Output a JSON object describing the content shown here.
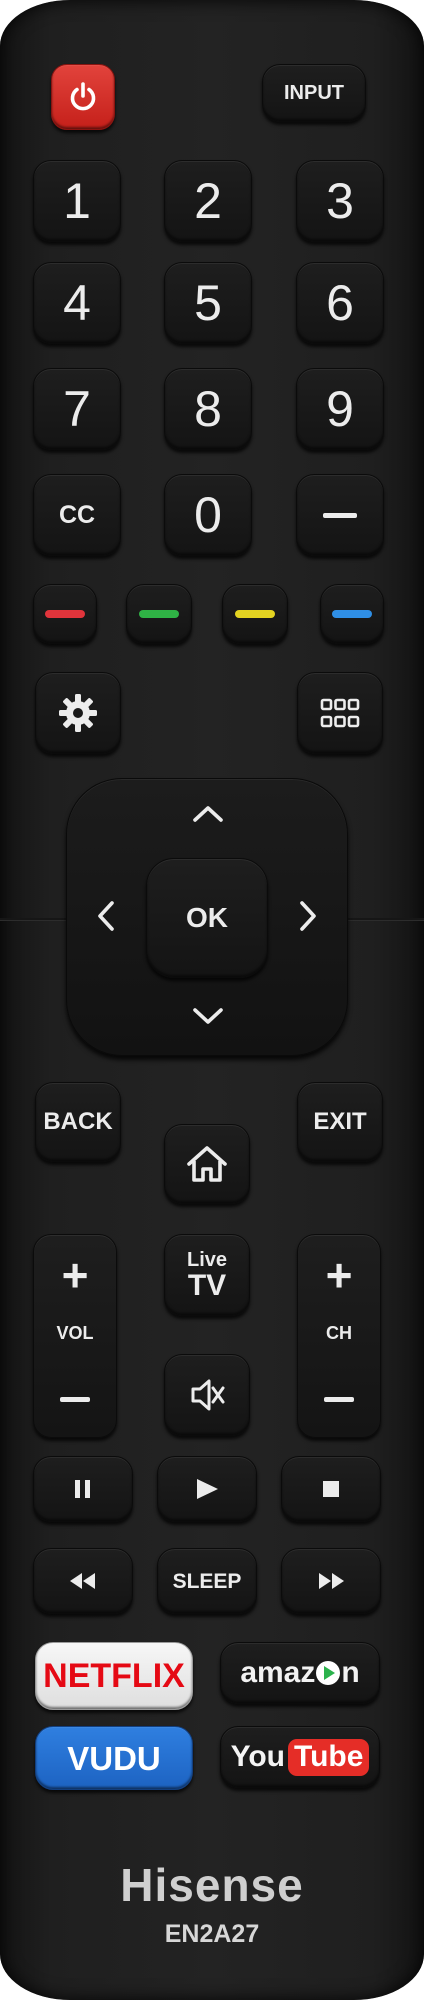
{
  "remote": {
    "brand": "Hisense",
    "model": "EN2A27",
    "accent_power": "#d7322b",
    "top": {
      "input_label": "INPUT"
    },
    "numbers": [
      "1",
      "2",
      "3",
      "4",
      "5",
      "6",
      "7",
      "8",
      "9",
      "0"
    ],
    "cc_label": "CC",
    "color_keys": [
      "#e0343b",
      "#2fb345",
      "#e3d321",
      "#2f8fe6"
    ],
    "nav": {
      "ok_label": "OK"
    },
    "back_label": "BACK",
    "exit_label": "EXIT",
    "live_tv": {
      "line1": "Live",
      "line2": "TV"
    },
    "vol_label": "VOL",
    "ch_label": "CH",
    "sleep_label": "SLEEP",
    "apps": {
      "netflix": "NETFLIX",
      "amazon_prefix": "amaz",
      "amazon_suffix": "n",
      "vudu": "VUDU",
      "youtube_you": "You",
      "youtube_tube": "Tube"
    }
  }
}
